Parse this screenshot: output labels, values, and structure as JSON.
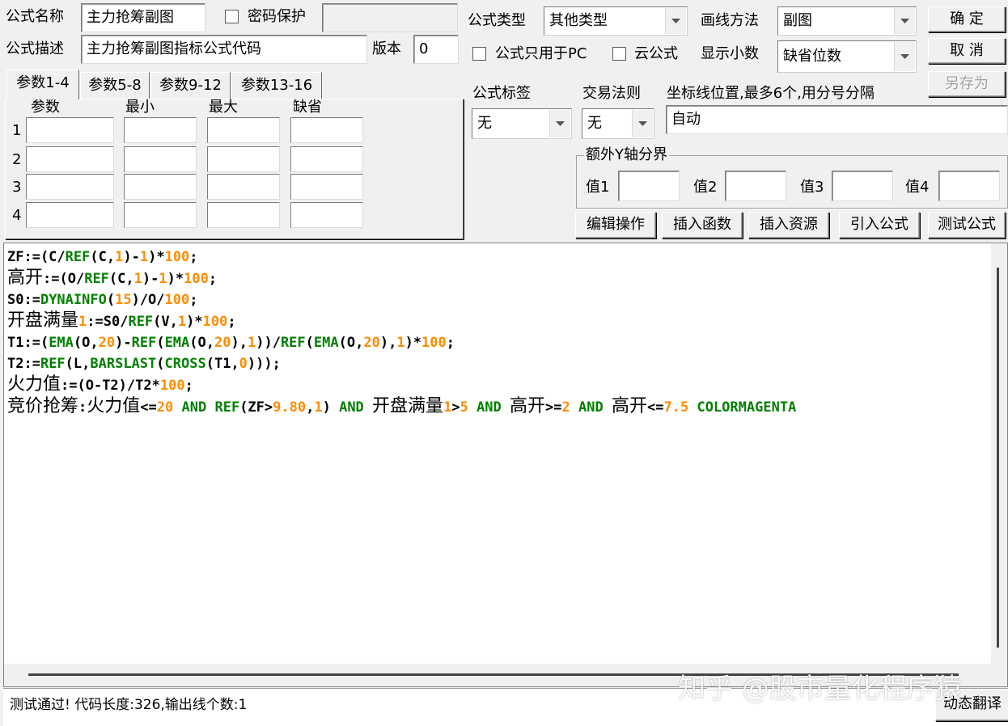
{
  "header": {
    "name_label": "公式名称",
    "name_value": "主力抢筹副图",
    "password_label": "密码保护",
    "desc_label": "公式描述",
    "desc_value": "主力抢筹副图指标公式代码",
    "version_label": "版本",
    "version_value": "0",
    "type_label": "公式类型",
    "type_value": "其他类型",
    "draw_label": "画线方法",
    "draw_value": "副图",
    "pc_only_label": "公式只用于PC",
    "cloud_label": "云公式",
    "decimals_label": "显示小数",
    "decimals_value": "缺省位数"
  },
  "buttons": {
    "ok": "确  定",
    "cancel": "取  消",
    "save_as": "另存为",
    "edit_ops": "编辑操作",
    "insert_func": "插入函数",
    "insert_res": "插入资源",
    "import_formula": "引入公式",
    "test_formula": "测试公式",
    "translate": "动态翻译"
  },
  "params": {
    "tabs": [
      "参数1-4",
      "参数5-8",
      "参数9-12",
      "参数13-16"
    ],
    "columns": [
      "参数",
      "最小",
      "最大",
      "缺省"
    ],
    "rows": [
      "1",
      "2",
      "3",
      "4"
    ]
  },
  "options": {
    "tag_label": "公式标签",
    "tag_value": "无",
    "rule_label": "交易法则",
    "rule_value": "无",
    "coord_label": "坐标线位置,最多6个,用分号分隔",
    "coord_value": "自动",
    "yaxis_title": "额外Y轴分界",
    "yaxis_values": [
      "值1",
      "值2",
      "值3",
      "值4"
    ]
  },
  "code_lines": [
    "ZF:=(C/REF(C,1)-1)*100;",
    "高开:=(O/REF(C,1)-1)*100;",
    "S0:=DYNAINFO(15)/O/100;",
    "开盘满量1:=S0/REF(V,1)*100;",
    "T1:=(EMA(O,20)-REF(EMA(O,20),1))/REF(EMA(O,20),1)*100;",
    "T2:=REF(L,BARSLAST(CROSS(T1,0)));",
    "火力值:=(O-T2)/T2*100;",
    "竞价抢筹:火力值<=20 AND REF(ZF>9.80,1) AND 开盘满量1>5 AND 高开>=2 AND 高开<=7.5 COLORMAGENTA"
  ],
  "status": {
    "message": "测试通过! 代码长度:326,输出线个数:1"
  },
  "watermark": "知乎 @股市量化程序猿",
  "colors": {
    "function": "#008000",
    "number": "#ff8c00",
    "text": "#000000",
    "window": "#f0f0f0"
  }
}
